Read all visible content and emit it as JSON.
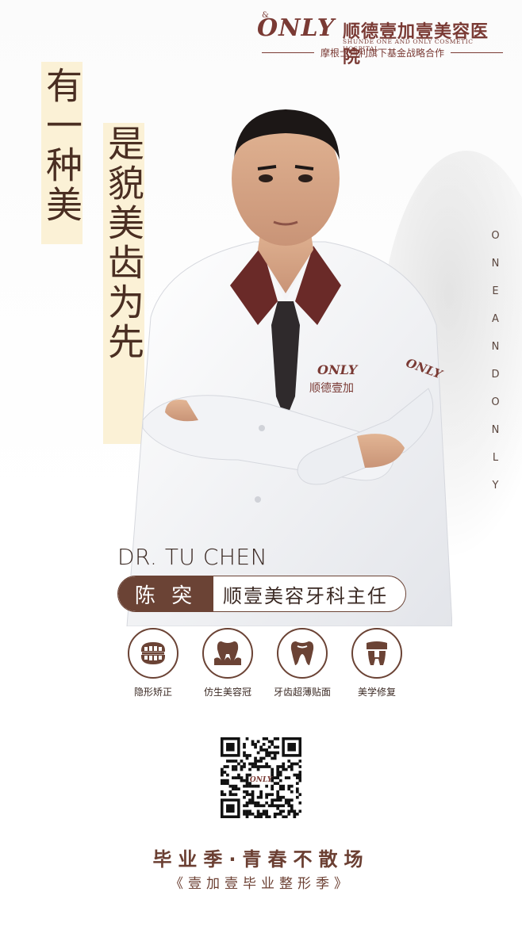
{
  "brand": {
    "logo_text": "ONLY",
    "logo_amp": "&",
    "name": "顺德壹加壹美容医院",
    "english": "SHUNDE ONE AND ONLY COSMETIC HOSPITAL",
    "partner": "摩根士丹利旗下基金战略合作"
  },
  "slogan": {
    "line1": "有一种美",
    "line2": "是貌美齿为先"
  },
  "vertical_english": "ONEANDONLY",
  "doctor": {
    "english_name": "DR. TU CHEN",
    "chinese_name": "陈 突",
    "title": "顺壹美容牙科主任",
    "coat_logo_text": "ONLY",
    "coat_name_text": "顺德壹加",
    "sleeve_logo_text": "ONLY"
  },
  "services": [
    {
      "label": "隐形矫正",
      "icon": "braces-icon"
    },
    {
      "label": "仿生美容冠",
      "icon": "tooth-gum-icon"
    },
    {
      "label": "牙齿超薄贴面",
      "icon": "tooth-icon"
    },
    {
      "label": "美学修复",
      "icon": "tooth-crown-icon"
    }
  ],
  "qr": {
    "center_text": "ONLY"
  },
  "footer": {
    "title": "毕业季·青春不散场",
    "subtitle": "《壹加壹毕业整形季》"
  },
  "colors": {
    "brand_brown": "#6b4335",
    "logo_red": "#7a3a34",
    "slogan_highlight": "#fbf1d6"
  }
}
